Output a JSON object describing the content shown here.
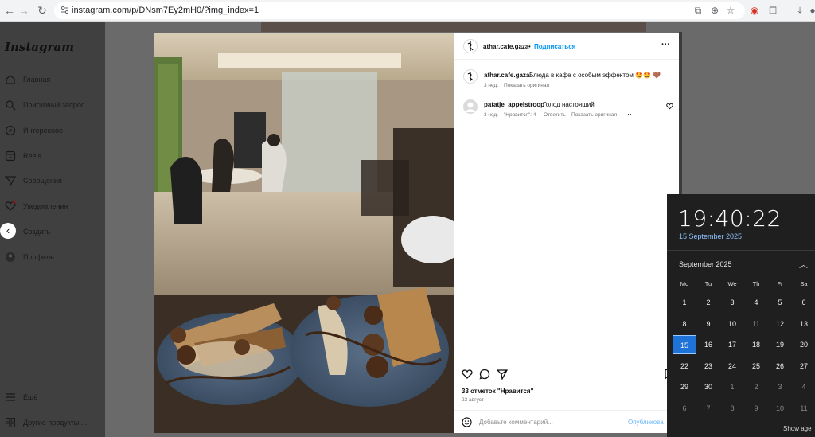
{
  "browser": {
    "url": "instagram.com/p/DNsm7Ey2mH0/?img_index=1"
  },
  "sidebar": {
    "logo": "Instagram",
    "items": [
      {
        "label": "Главная",
        "icon": "home-icon"
      },
      {
        "label": "Поисковый запрос",
        "icon": "search-icon"
      },
      {
        "label": "Интересное",
        "icon": "compass-icon"
      },
      {
        "label": "Reels",
        "icon": "reels-icon"
      },
      {
        "label": "Сообщения",
        "icon": "send-icon"
      },
      {
        "label": "Уведомления",
        "icon": "heart-icon"
      },
      {
        "label": "Создать",
        "icon": "plus-icon"
      },
      {
        "label": "Профиль",
        "icon": "avatar-icon"
      }
    ],
    "bottom": [
      {
        "label": "Ещё",
        "icon": "menu-icon"
      },
      {
        "label": "Другие продукты ...",
        "icon": "apps-icon"
      }
    ]
  },
  "post": {
    "username": "athar.cafe.gaza",
    "dot": "•",
    "follow": "Подписаться",
    "caption_user": "athar.cafe.gaza",
    "caption_text": "Блюда в кафе с особым эффектом 🤩🤩 🤎",
    "caption_age": "3 нед.",
    "caption_translate": "Показать оригинал",
    "comment": {
      "user": "patatje_appelstroop",
      "text": "Голод настоящий",
      "age": "3 нед.",
      "likes": "\"Нравится\": 4",
      "reply": "Ответить",
      "translate": "Показать оригинал"
    },
    "likes": "33 отметок \"Нравится\"",
    "date": "23 август",
    "comment_placeholder": "Добавьте комментарий...",
    "publish": "Опубликова"
  },
  "clock": {
    "time": "19:40:22",
    "date": "15 September 2025",
    "month": "September 2025",
    "weekdays": [
      "Mo",
      "Tu",
      "We",
      "Th",
      "Fr",
      "Sa"
    ],
    "weeks": [
      [
        "1",
        "2",
        "3",
        "4",
        "5",
        "6"
      ],
      [
        "8",
        "9",
        "10",
        "11",
        "12",
        "13"
      ],
      [
        "15",
        "16",
        "17",
        "18",
        "19",
        "20"
      ],
      [
        "22",
        "23",
        "24",
        "25",
        "26",
        "27"
      ],
      [
        "29",
        "30",
        "1",
        "2",
        "3",
        "4"
      ],
      [
        "6",
        "7",
        "8",
        "9",
        "10",
        "11"
      ]
    ],
    "selected": "15",
    "show_agenda": "Show age"
  },
  "colors": {
    "accent": "#0095f6",
    "clock_bg": "#1f1f1f",
    "today": "#1e73d8"
  }
}
